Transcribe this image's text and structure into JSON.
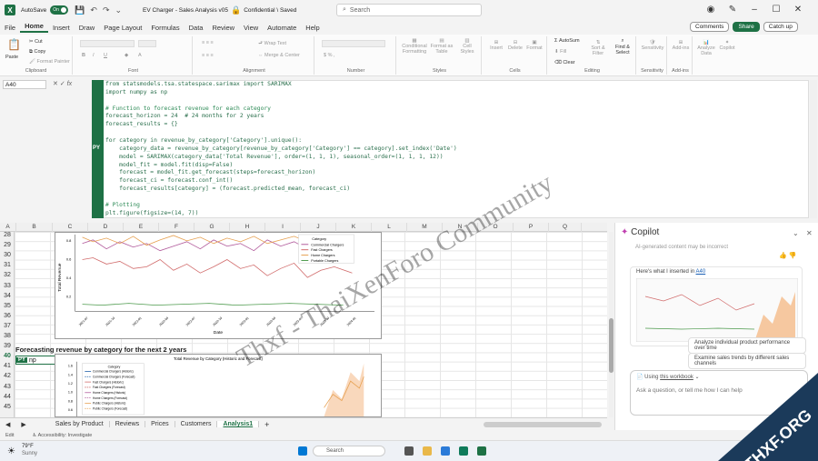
{
  "titlebar": {
    "autosave": "AutoSave",
    "toggle": "On",
    "filename": "EV Charger - Sales Analysis v05",
    "sensitivity": "Confidential \\ Saved",
    "search_placeholder": "Search"
  },
  "menu": {
    "tabs": [
      "File",
      "Home",
      "Insert",
      "Draw",
      "Page Layout",
      "Formulas",
      "Data",
      "Review",
      "View",
      "Automate",
      "Help"
    ],
    "active": "Home",
    "comments": "Comments",
    "share": "Share",
    "catchup": "Catch up"
  },
  "ribbon": {
    "groups": [
      "Clipboard",
      "Font",
      "Alignment",
      "Number",
      "Styles",
      "Cells",
      "Editing",
      "Sensitivity",
      "Add-ins"
    ],
    "paste": "Paste",
    "cut": "Cut",
    "copy": "Copy",
    "format_painter": "Format Painter",
    "wrap_text": "Wrap Text",
    "merge_center": "Merge & Center",
    "conditional": "Conditional Formatting",
    "format_table": "Format as Table",
    "cell_styles": "Cell Styles",
    "insert": "Insert",
    "delete": "Delete",
    "format": "Format",
    "autosum": "AutoSum",
    "fill": "Fill",
    "clear": "Clear",
    "sort_filter": "Sort & Filter",
    "find_select": "Find & Select",
    "sensitivity": "Sensitivity",
    "addins": "Add-ins",
    "analyze": "Analyze Data",
    "copilot": "Copilot"
  },
  "formula": {
    "namebox": "A40",
    "py": "PY",
    "code_lines": [
      "from statsmodels.tsa.statespace.sarimax import SARIMAX",
      "import numpy as np",
      "",
      "# Function to forecast revenue for each category",
      "forecast_horizon = 24  # 24 months for 2 years",
      "forecast_results = {}",
      "",
      "for category in revenue_by_category['Category'].unique():",
      "    category_data = revenue_by_category[revenue_by_category['Category'] == category].set_index('Date')",
      "    model = SARIMAX(category_data['Total Revenue'], order=(1, 1, 1), seasonal_order=(1, 1, 1, 12))",
      "    model_fit = model.fit(disp=False)",
      "    forecast = model_fit.get_forecast(steps=forecast_horizon)",
      "    forecast_ci = forecast.conf_int()",
      "    forecast_results[category] = (forecast.predicted_mean, forecast_ci)",
      "",
      "# Plotting",
      "plt.figure(figsize=(14, 7))"
    ]
  },
  "grid": {
    "columns": [
      "A",
      "B",
      "C",
      "D",
      "E",
      "F",
      "G",
      "H",
      "I",
      "J",
      "K",
      "L",
      "M",
      "N",
      "O",
      "P",
      "Q"
    ],
    "rows": [
      "28",
      "29",
      "30",
      "31",
      "32",
      "33",
      "34",
      "35",
      "36",
      "37",
      "38",
      "39",
      "40",
      "41",
      "42",
      "43",
      "44",
      "45"
    ],
    "heading": "Forecasting revenue by category for the next 2 years",
    "a40_tag": "PY",
    "a40_value": "np"
  },
  "chart1": {
    "legend_title": "Category",
    "legend": [
      "Commercial Chargers",
      "Fast Chargers",
      "Home Chargers",
      "Portable Chargers"
    ],
    "yticks": [
      "0.8",
      "0.6",
      "0.4",
      "0.2"
    ],
    "xticks": [
      "2021-07",
      "2021-10",
      "2022-01",
      "2022-04",
      "2022-07",
      "2022-10",
      "2023-01",
      "2023-04",
      "2023-07",
      "2023-10",
      "2024-01"
    ],
    "xlabel": "Date",
    "ylabel": "Total Revenue"
  },
  "chart2": {
    "title": "Total Revenue by Category (Historic and Forecast)",
    "legend_title": "Category",
    "legend": [
      "Commercial Chargers (Historic)",
      "Commercial Chargers (Forecast)",
      "Fast Chargers (Historic)",
      "Fast Chargers (Forecast)",
      "Home Chargers (Historic)",
      "Home Chargers (Forecast)",
      "Public Chargers (Historic)",
      "Public Chargers (Forecast)"
    ],
    "yticks": [
      "1.6",
      "1.4",
      "1.2",
      "1.0",
      "0.8",
      "0.6"
    ]
  },
  "sheets": {
    "tabs": [
      "Sales by Product",
      "Reviews",
      "Prices",
      "Customers",
      "Analysis1"
    ],
    "active": "Analysis1"
  },
  "status": {
    "edit": "Edit",
    "accessibility": "Accessibility: Investigate"
  },
  "copilot": {
    "title": "Copilot",
    "banner": "AI-generated content may be incorrect",
    "message": "Here's what I inserted in ",
    "link": "A40",
    "suggestion1": "Analyze individual product performance over time",
    "suggestion2": "Examine sales trends by different sales channels",
    "using": "Using ",
    "workbook": "this workbook",
    "input_placeholder": "Ask a question, or tell me how I can help"
  },
  "taskbar": {
    "temp": "79°F",
    "weather": "Sunny",
    "search": "Search"
  },
  "watermark": {
    "text": "Thxf - ThaiXenForo Community",
    "logo": "THXF.ORG"
  }
}
